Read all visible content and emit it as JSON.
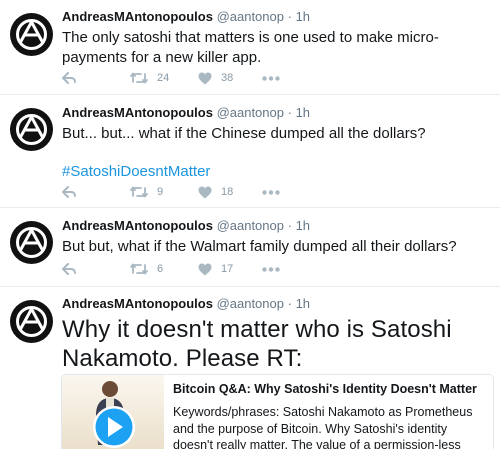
{
  "colors": {
    "hashtag": "#1b95e0",
    "action_icon": "#aab8c2",
    "divider": "#e6ecf0",
    "play_button": "#1da1f2"
  },
  "tweets": [
    {
      "name": "AndreasMAntonopoulos",
      "handle": "@aantonop",
      "dot": "·",
      "time": "1h",
      "text": "The only satoshi that matters is one used to make micro-payments for a new killer app.",
      "retweets": "24",
      "likes": "38"
    },
    {
      "name": "AndreasMAntonopoulos",
      "handle": "@aantonop",
      "dot": "·",
      "time": "1h",
      "text": "But... but... what if the Chinese dumped all the dollars?",
      "hashtag": "#SatoshiDoesntMatter",
      "retweets": "9",
      "likes": "18"
    },
    {
      "name": "AndreasMAntonopoulos",
      "handle": "@aantonop",
      "dot": "·",
      "time": "1h",
      "text": "But but, what if the Walmart family dumped all their dollars?",
      "retweets": "6",
      "likes": "17"
    },
    {
      "name": "AndreasMAntonopoulos",
      "handle": "@aantonop",
      "dot": "·",
      "time": "1h",
      "text": "Why it doesn't matter who is Satoshi Nakamoto. Please RT:",
      "card": {
        "title": "Bitcoin Q&A: Why Satoshi's Identity Doesn't Matter",
        "description": "Keywords/phrases: Satoshi Nakamoto as Prometheus and the purpose of Bitcoin. Why Satoshi's identity doesn't really matter. The value of a permission-less sys..."
      }
    }
  ],
  "icons": {
    "avatar": "anarchy-logo-avatar",
    "reply": "reply-icon",
    "retweet": "retweet-icon",
    "like": "heart-icon",
    "more": "more-dots-icon",
    "play": "play-icon"
  }
}
